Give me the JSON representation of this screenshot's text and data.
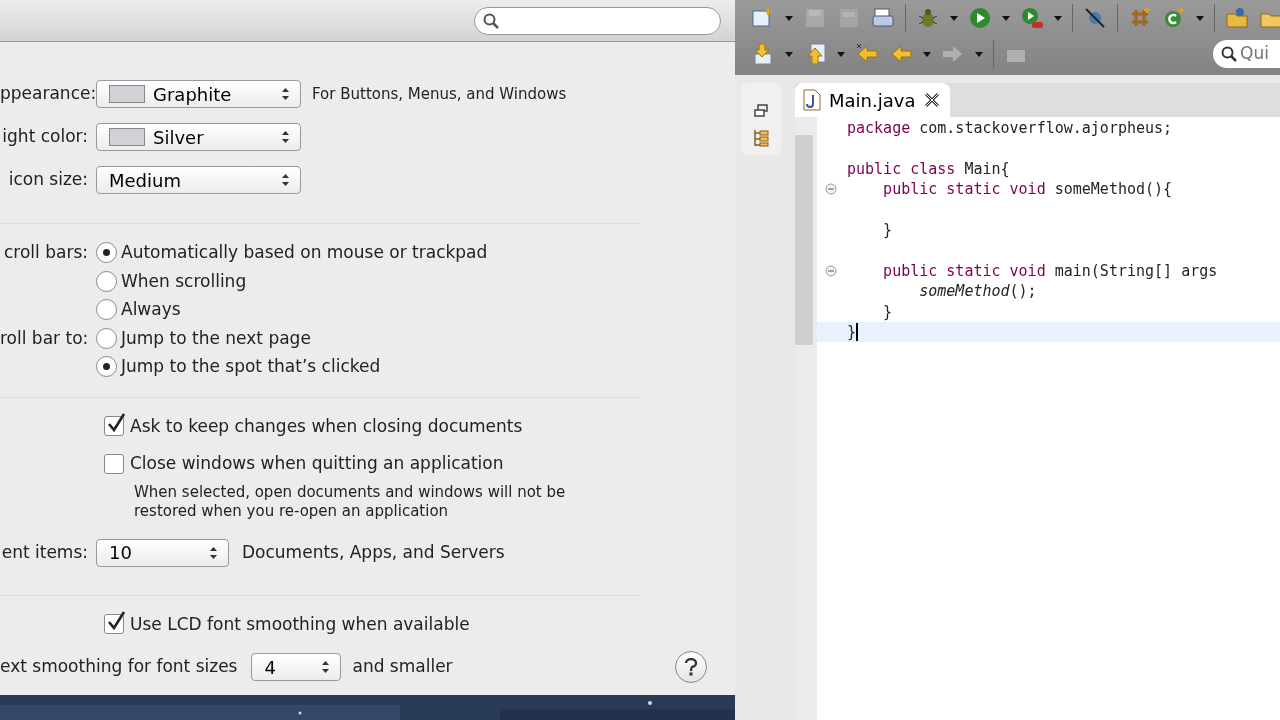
{
  "preferences": {
    "rows": [
      {
        "kind": "popup",
        "label": "ppearance:",
        "value": "Graphite",
        "swatch": true,
        "note": "For Buttons, Menus, and Windows"
      },
      {
        "kind": "popup",
        "label": "ight color:",
        "value": "Silver",
        "swatch": true
      },
      {
        "kind": "popup",
        "label": "icon size:",
        "value": "Medium"
      },
      {
        "kind": "separator"
      },
      {
        "kind": "radios",
        "label": "croll bars:",
        "options": [
          {
            "text": "Automatically based on mouse or trackpad",
            "selected": true
          },
          {
            "text": "When scrolling",
            "selected": false
          },
          {
            "text": "Always",
            "selected": false
          }
        ]
      },
      {
        "kind": "radios",
        "label": "roll bar to:",
        "options": [
          {
            "text": "Jump to the next page",
            "selected": false
          },
          {
            "text": "Jump to the spot that’s clicked",
            "selected": true
          }
        ]
      },
      {
        "kind": "separator"
      },
      {
        "kind": "check",
        "text": "Ask to keep changes when closing documents",
        "checked": true
      },
      {
        "kind": "check",
        "text": "Close windows when quitting an application",
        "checked": false,
        "hint": "When selected, open documents and windows will not be restored when you re-open an application"
      },
      {
        "kind": "small-popup",
        "label": "ent items:",
        "value": "10",
        "note": "Documents, Apps, and Servers"
      },
      {
        "kind": "separator"
      },
      {
        "kind": "check",
        "text": "Use LCD font smoothing when available",
        "checked": true
      },
      {
        "kind": "inline-popup",
        "label": "ext smoothing for font sizes",
        "value": "4",
        "note": "and smaller"
      }
    ]
  },
  "eclipse": {
    "quick_access": {
      "placeholder": "Qui"
    },
    "tab": {
      "title": "Main.java",
      "selected": true
    },
    "lines": [
      {
        "fold": false,
        "current": false,
        "tokens": [
          {
            "kind": "keyword",
            "text": "package"
          },
          {
            "kind": "plain",
            "text": " com.stackoverflow.ajorpheus;"
          }
        ]
      },
      {
        "fold": false,
        "current": false
      },
      {
        "fold": false,
        "current": false,
        "tokens": [
          {
            "kind": "keyword",
            "text": "public class"
          },
          {
            "kind": "plain",
            "text": " Main{"
          }
        ]
      },
      {
        "fold": true,
        "current": false,
        "tokens": [
          {
            "kind": "keyword",
            "text": "    public static void"
          },
          {
            "kind": "plain",
            "text": " someMethod(){"
          }
        ]
      },
      {
        "fold": false,
        "current": false
      },
      {
        "fold": false,
        "current": false,
        "tokens": [
          {
            "kind": "plain",
            "text": "    }"
          }
        ]
      },
      {
        "fold": false,
        "current": false
      },
      {
        "fold": true,
        "current": false,
        "tokens": [
          {
            "kind": "keyword",
            "text": "    public static void"
          },
          {
            "kind": "plain",
            "text": " main(String[] args"
          }
        ]
      },
      {
        "fold": false,
        "current": false,
        "tokens": [
          {
            "kind": "italic",
            "text": "        someMethod"
          },
          {
            "kind": "plain",
            "text": "();"
          }
        ]
      },
      {
        "fold": false,
        "current": false,
        "tokens": [
          {
            "kind": "plain",
            "text": "    }"
          }
        ]
      },
      {
        "fold": false,
        "current": true,
        "tokens": [
          {
            "kind": "plain",
            "text": "}"
          }
        ]
      }
    ]
  }
}
